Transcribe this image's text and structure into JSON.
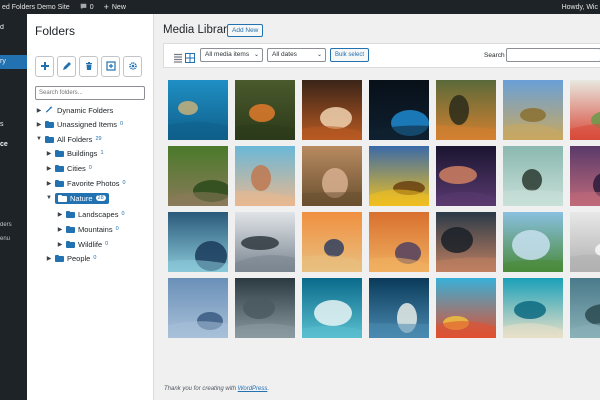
{
  "admin_bar": {
    "site_name": "ed Folders Demo Site",
    "comments_count": "0",
    "new_label": "New",
    "greeting": "Howdy, Wic"
  },
  "admin_menu": {
    "items": [
      {
        "label": "d"
      },
      {
        "label": "ry"
      },
      {
        "label": ""
      },
      {
        "label": ""
      },
      {
        "label": "s"
      },
      {
        "label": "ce"
      },
      {
        "label": "ders"
      },
      {
        "label": "enu"
      }
    ]
  },
  "folders_panel": {
    "title": "Folders",
    "search_placeholder": "Search folders...",
    "tools": [
      {
        "icon": "plus-icon"
      },
      {
        "icon": "pencil-icon"
      },
      {
        "icon": "trash-icon"
      },
      {
        "icon": "collapse-icon"
      },
      {
        "icon": "gear-icon"
      }
    ],
    "tree": [
      {
        "label": "Dynamic Folders",
        "count": "",
        "depth": 0,
        "icon": "magic-wand-icon",
        "expanded": false
      },
      {
        "label": "Unassigned Items",
        "count": "0",
        "depth": 0,
        "icon": "folder-icon",
        "expanded": false
      },
      {
        "label": "All Folders",
        "count": "29",
        "depth": 0,
        "icon": "folder-icon",
        "expanded": true
      },
      {
        "label": "Buildings",
        "count": "1",
        "depth": 1,
        "icon": "folder-icon",
        "expanded": false
      },
      {
        "label": "Cities",
        "count": "0",
        "depth": 1,
        "icon": "folder-icon",
        "expanded": false
      },
      {
        "label": "Favorite Photos",
        "count": "0",
        "depth": 1,
        "icon": "folder-icon",
        "expanded": false
      },
      {
        "label": "Nature",
        "count": "28",
        "depth": 1,
        "icon": "folder-icon",
        "expanded": true,
        "selected": true
      },
      {
        "label": "Landscapes",
        "count": "0",
        "depth": 2,
        "icon": "folder-icon",
        "expanded": false
      },
      {
        "label": "Mountains",
        "count": "0",
        "depth": 2,
        "icon": "folder-icon",
        "expanded": false
      },
      {
        "label": "Wildlife",
        "count": "0",
        "depth": 2,
        "icon": "folder-icon",
        "expanded": false
      },
      {
        "label": "People",
        "count": "0",
        "depth": 1,
        "icon": "folder-icon",
        "expanded": false
      }
    ]
  },
  "media_library": {
    "title": "Media Library",
    "add_new_label": "Add New",
    "filter_type": "All media items",
    "filter_date": "All dates",
    "bulk_select_label": "Bulk select",
    "search_label": "Search",
    "search_value": "",
    "thumbnails": [
      {
        "subject": "sea-turtle",
        "colors": [
          "#1f8fc4",
          "#0f5f8a",
          "#c7b07a"
        ]
      },
      {
        "subject": "kingfisher",
        "colors": [
          "#4a5a2c",
          "#2c3a1a",
          "#e07a2a"
        ]
      },
      {
        "subject": "fox",
        "colors": [
          "#3a2418",
          "#b85a22",
          "#f0d2b0"
        ]
      },
      {
        "subject": "blue-snake",
        "colors": [
          "#081018",
          "#0f2030",
          "#1e8ad0"
        ]
      },
      {
        "subject": "tiger",
        "colors": [
          "#5a6a3a",
          "#d48030",
          "#2a2a1a"
        ]
      },
      {
        "subject": "mountain-valley",
        "colors": [
          "#6aa0d8",
          "#c8a860",
          "#8a7030"
        ]
      },
      {
        "subject": "tulips",
        "colors": [
          "#e8e8e0",
          "#d84a3a",
          "#6a9a4a"
        ]
      },
      {
        "subject": "owl",
        "colors": [
          "#4a7a2a",
          "#8a7a5a",
          "#2a4a1a"
        ]
      },
      {
        "subject": "desert-dunes",
        "colors": [
          "#6ab8d8",
          "#e8b890",
          "#c07850"
        ]
      },
      {
        "subject": "elephant",
        "colors": [
          "#b88a60",
          "#6a5030",
          "#d8b090"
        ]
      },
      {
        "subject": "sunflower",
        "colors": [
          "#3a6aa8",
          "#f0c020",
          "#6a4010"
        ]
      },
      {
        "subject": "night-sky",
        "colors": [
          "#1a1530",
          "#5a3a70",
          "#d08060"
        ]
      },
      {
        "subject": "bird-in-mist",
        "colors": [
          "#8ab8b0",
          "#c8e0d8",
          "#2a3a30"
        ]
      },
      {
        "subject": "sunset-purple",
        "colors": [
          "#5a3a6a",
          "#c06a7a",
          "#2a1a3a"
        ]
      },
      {
        "subject": "cactus-pattern",
        "colors": [
          "#2a5a7a",
          "#8ac8d8",
          "#1a3a5a"
        ]
      },
      {
        "subject": "snowy-peaks",
        "colors": [
          "#e0e4e8",
          "#7a8590",
          "#303840"
        ]
      },
      {
        "subject": "forest-sunrise",
        "colors": [
          "#f09040",
          "#e8c080",
          "#304060"
        ]
      },
      {
        "subject": "orange-clouds",
        "colors": [
          "#d87030",
          "#f0b060",
          "#504060"
        ]
      },
      {
        "subject": "lake-mountains",
        "colors": [
          "#2a3a48",
          "#c08060",
          "#1a2028"
        ]
      },
      {
        "subject": "lone-tree",
        "colors": [
          "#8ac0e0",
          "#4a8a3a",
          "#c8e0f0"
        ]
      },
      {
        "subject": "white-misc",
        "colors": [
          "#e8e8e8",
          "#b0b0b0",
          "#f8f8f8"
        ]
      },
      {
        "subject": "misty-hills",
        "colors": [
          "#6a90b8",
          "#a8c0d8",
          "#3a5a80"
        ]
      },
      {
        "subject": "texture-spines",
        "colors": [
          "#2a3a40",
          "#8a9aa0",
          "#4a5a60"
        ]
      },
      {
        "subject": "ocean-wave",
        "colors": [
          "#0a6a8a",
          "#5ac0d0",
          "#e8f4f4"
        ]
      },
      {
        "subject": "aerial-coast",
        "colors": [
          "#0a3a5a",
          "#4a8ab0",
          "#e8ece8"
        ]
      },
      {
        "subject": "hot-air-balloons",
        "colors": [
          "#38b0d8",
          "#e05030",
          "#f0c040"
        ]
      },
      {
        "subject": "beach-aerial",
        "colors": [
          "#1aa0b8",
          "#e8e0c8",
          "#0a6a80"
        ]
      },
      {
        "subject": "lake-edge",
        "colors": [
          "#4a7a8a",
          "#8ab0b8",
          "#2a4a50"
        ]
      }
    ]
  },
  "footer": {
    "text": "Thank you for creating with ",
    "link": "WordPress",
    "period": "."
  }
}
